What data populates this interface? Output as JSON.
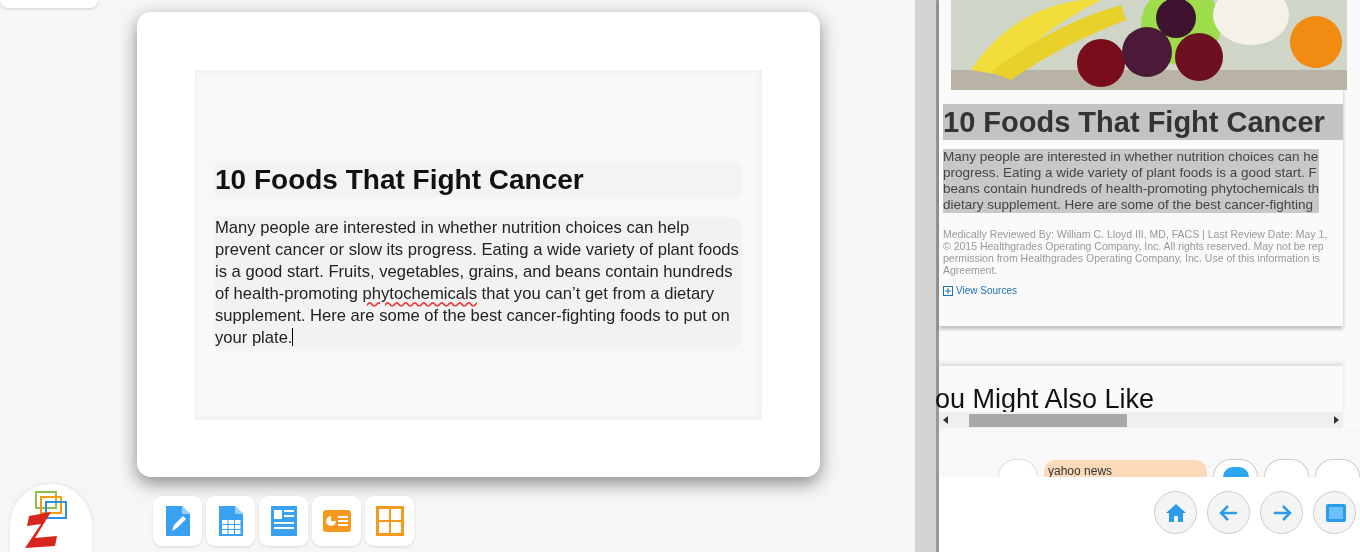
{
  "editor": {
    "title": "10 Foods That Fight Cancer",
    "body": [
      {
        "text": "Many people are interested in whether nutrition choices can help prevent cancer or slow its progress. Eating a wide variety of plant foods is a good start. Fruits, vegetables, grains, and beans contain hundreds of health-promoting ",
        "misspelled": false
      },
      {
        "text": "phytochemicals",
        "misspelled": true
      },
      {
        "text": " that you can’t get from a dietary supplement. Here are some of the best cancer-fighting foods to put on your plate.",
        "misspelled": false
      }
    ]
  },
  "dock": [
    {
      "kind": "writer"
    },
    {
      "kind": "sheet"
    },
    {
      "kind": "document"
    },
    {
      "kind": "slides"
    },
    {
      "kind": "grid"
    }
  ],
  "browser": {
    "title": "10 Foods That Fight Cancer",
    "summary_lines": [
      "Many people are interested in whether nutrition choices can he",
      "progress. Eating a wide variety of plant foods is a good start. F",
      "beans contain hundreds of health-promoting phytochemicals th",
      "dietary supplement. Here are some of the best cancer-fighting"
    ],
    "meta_lines": [
      "Medically Reviewed By: William C. Lloyd III, MD, FACS | Last Review Date: May 1,",
      "© 2015 Healthgrades Operating Company, Inc. All rights reserved. May not be rep",
      "permission from Healthgrades Operating Company, Inc. Use of this information is",
      "Agreement."
    ],
    "sources_link": "View Sources",
    "section_heading": "ou Might Also Like",
    "search_chip": "yahoo news",
    "nav_buttons": [
      {
        "kind": "home"
      },
      {
        "kind": "back"
      },
      {
        "kind": "forward"
      },
      {
        "kind": "window"
      }
    ]
  }
}
